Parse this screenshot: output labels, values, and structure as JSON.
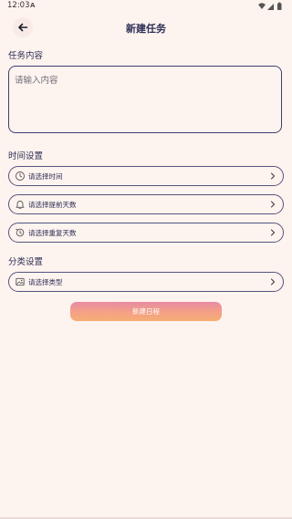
{
  "status_bar": {
    "time": "12:03",
    "app_badge": "A",
    "icons": [
      "wifi-icon",
      "signal-icon",
      "battery-icon"
    ]
  },
  "header": {
    "title": "新建任务",
    "back_icon": "arrow-left-icon"
  },
  "content_section": {
    "title": "任务内容",
    "placeholder": "请输入内容",
    "value": ""
  },
  "time_section": {
    "title": "时间设置",
    "items": [
      {
        "label": "请选择时间",
        "icon": "clock-icon"
      },
      {
        "label": "请选择提前天数",
        "icon": "bell-icon"
      },
      {
        "label": "请选择重复天数",
        "icon": "history-icon"
      }
    ]
  },
  "category_section": {
    "title": "分类设置",
    "items": [
      {
        "label": "请选择类型",
        "icon": "image-icon"
      }
    ]
  },
  "submit": {
    "label": "新建日程",
    "enabled": false
  },
  "colors": {
    "background": "#fdf3ef",
    "text": "#2e2f55",
    "border": "#3f4070",
    "button_gradient": [
      "#e37a95",
      "#f39373",
      "#f5a15e"
    ]
  }
}
